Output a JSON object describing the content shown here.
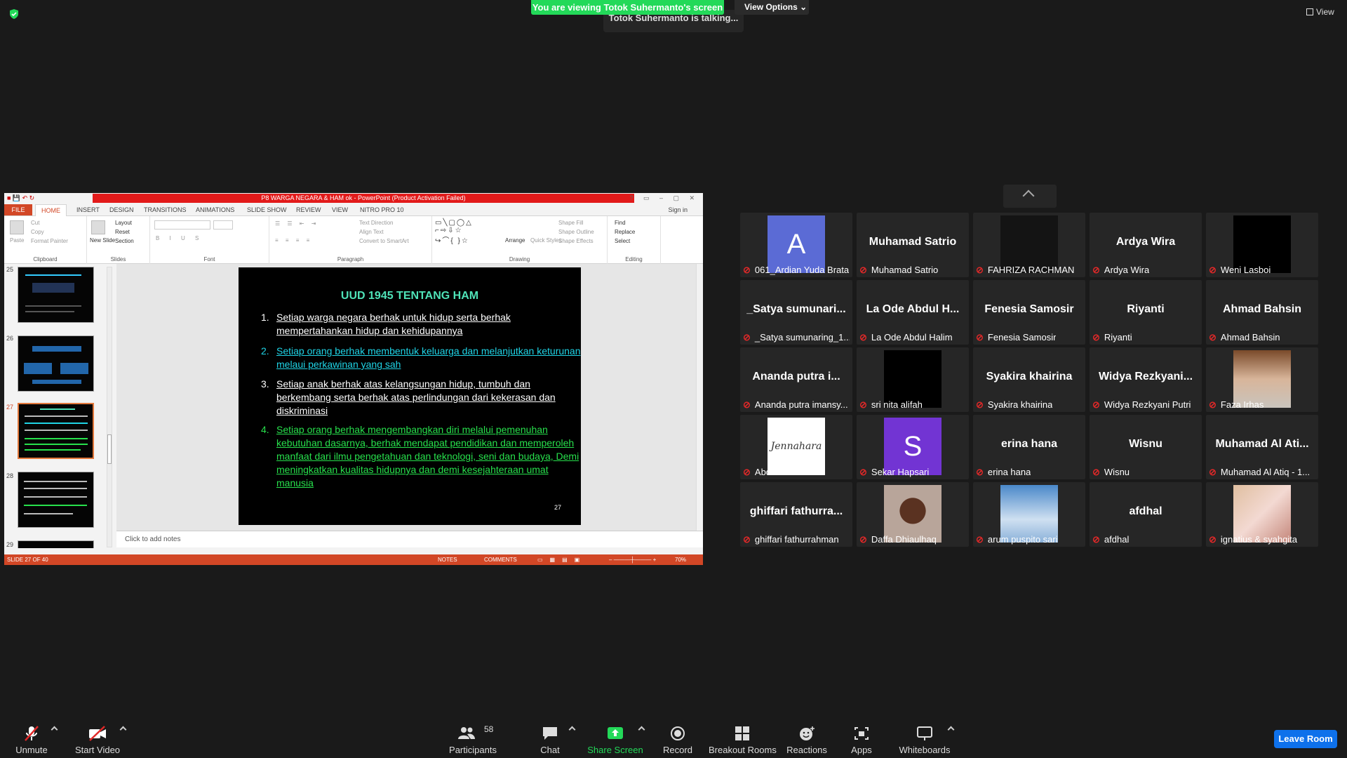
{
  "top": {
    "banner": "You are viewing Totok Suhermanto's screen",
    "view_options": "View Options",
    "talking": "Totok Suhermanto is talking...",
    "view": "View"
  },
  "ppt": {
    "title": "P8 WARGA NEGARA & HAM ok -  PowerPoint (Product Activation Failed)",
    "tabs": [
      "FILE",
      "HOME",
      "INSERT",
      "DESIGN",
      "TRANSITIONS",
      "ANIMATIONS",
      "SLIDE SHOW",
      "REVIEW",
      "VIEW",
      "NITRO PRO 10"
    ],
    "sign_in": "Sign in",
    "groups": {
      "clipboard": "Clipboard",
      "slides": "Slides",
      "font": "Font",
      "paragraph": "Paragraph",
      "drawing": "Drawing",
      "editing": "Editing"
    },
    "clipboard_items": {
      "paste": "Paste",
      "cut": "Cut",
      "copy": "Copy",
      "format_painter": "Format Painter"
    },
    "slides_items": {
      "new_slide": "New Slide",
      "layout": "Layout",
      "reset": "Reset",
      "section": "Section"
    },
    "paragraph_items": {
      "text_direction": "Text Direction",
      "align_text": "Align Text",
      "smartart": "Convert to SmartArt"
    },
    "drawing_items": {
      "arrange": "Arrange",
      "quick_styles": "Quick Styles",
      "shape_fill": "Shape Fill",
      "shape_outline": "Shape Outline",
      "shape_effects": "Shape Effects"
    },
    "editing_items": {
      "find": "Find",
      "replace": "Replace",
      "select": "Select"
    },
    "thumb_numbers": [
      "25",
      "26",
      "27",
      "28",
      "29"
    ],
    "slide": {
      "title": "UUD 1945 TENTANG HAM",
      "items": [
        {
          "num": "1.",
          "text": "Setiap warga  negara berhak untuk hidup serta berhak mempertahankan hidup dan kehidupannya"
        },
        {
          "num": "2.",
          "text": "Setiap orang berhak membentuk keluarga dan melanjutkan keturunan melaui perkawinan yang sah"
        },
        {
          "num": "3.",
          "text": "Setiap anak berhak atas kelangsungan hidup, tumbuh dan berkembang serta berhak atas perlindungan dari kekerasan dan diskriminasi"
        },
        {
          "num": "4.",
          "text": "Setiap orang berhak mengembangkan diri melalui pemenuhan kebutuhan dasarnya, berhak mendapat pendidikan dan memperoleh manfaat dari ilmu pengetahuan dan teknologi, seni dan budaya, Demi meningkatkan kualitas hidupnya dan demi kesejahteraan umat manusia"
        }
      ],
      "number": "27"
    },
    "notes_placeholder": "Click to add notes",
    "status": {
      "slide": "SLIDE 27 OF 40",
      "notes": "NOTES",
      "comments": "COMMENTS",
      "zoom": "70%"
    }
  },
  "participants": [
    {
      "big": "",
      "name": "061_Ardian Yuda Brata",
      "avatar": "A"
    },
    {
      "big": "Muhamad Satrio",
      "name": "Muhamad Satrio"
    },
    {
      "big": "",
      "name": "FAHRIZA RACHMAN",
      "pic": "dark"
    },
    {
      "big": "Ardya Wira",
      "name": "Ardya Wira"
    },
    {
      "big": "",
      "name": "Weni Lasboi",
      "pic": "black"
    },
    {
      "big": "_Satya  sumunari...",
      "name": "_Satya sumunaring_1..."
    },
    {
      "big": "La Ode Abdul H...",
      "name": "La Ode Abdul Halim"
    },
    {
      "big": "Fenesia Samosir",
      "name": "Fenesia Samosir"
    },
    {
      "big": "Riyanti",
      "name": "Riyanti"
    },
    {
      "big": "Ahmad Bahsin",
      "name": "Ahmad Bahsin"
    },
    {
      "big": "Ananda putra i...",
      "name": "Ananda putra imansy..."
    },
    {
      "big": "",
      "name": "sri nita alifah",
      "pic": "black"
    },
    {
      "big": "Syakira khairina",
      "name": "Syakira khairina"
    },
    {
      "big": "Widya  Rezkyani...",
      "name": "Widya Rezkyani Putri"
    },
    {
      "big": "",
      "name": "Faza Irhas",
      "pic": "photo1"
    },
    {
      "big": "",
      "name": "Abdul Aziz Adha",
      "pic": "sign"
    },
    {
      "big": "",
      "name": "Sekar Hapsari",
      "avatar": "S"
    },
    {
      "big": "erina hana",
      "name": "erina hana"
    },
    {
      "big": "Wisnu",
      "name": "Wisnu"
    },
    {
      "big": "Muhamad Al Ati...",
      "name": "Muhamad Al Atiq - 1..."
    },
    {
      "big": "ghiffari  fathurra...",
      "name": "ghiffari fathurrahman"
    },
    {
      "big": "",
      "name": "Daffa Dhiaulhaq",
      "pic": "photo2"
    },
    {
      "big": "",
      "name": "arum puspito sari",
      "pic": "sky"
    },
    {
      "big": "afdhal",
      "name": "afdhal"
    },
    {
      "big": "",
      "name": "ignatius & syahgita",
      "pic": "photo3"
    }
  ],
  "sign_text": "Jennahara",
  "toolbar": {
    "unmute": "Unmute",
    "start_video": "Start Video",
    "participants": "Participants",
    "participants_count": "58",
    "chat": "Chat",
    "share_screen": "Share Screen",
    "record": "Record",
    "breakout": "Breakout Rooms",
    "reactions": "Reactions",
    "apps": "Apps",
    "whiteboards": "Whiteboards",
    "leave": "Leave Room"
  },
  "colors": {
    "banner": "#23d959",
    "ppt_accent": "#d24726",
    "leave": "#0e71eb",
    "muted_mic": "#e02828"
  }
}
